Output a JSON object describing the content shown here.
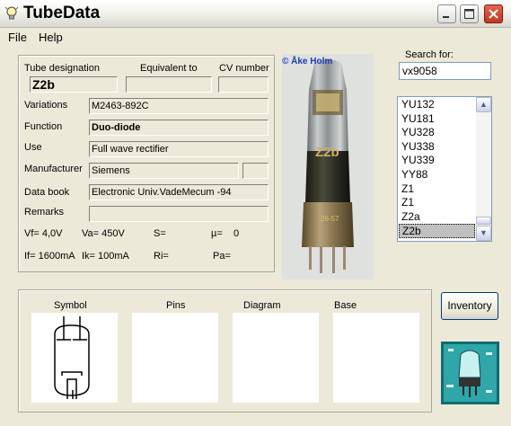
{
  "app": {
    "title": "TubeData"
  },
  "menu": {
    "file": "File",
    "help": "Help"
  },
  "header_labels": {
    "designation": "Tube designation",
    "equivalent": "Equivalent to",
    "cv": "CV number"
  },
  "tube": {
    "designation": "Z2b",
    "equivalent": "",
    "cv": "",
    "variations": "M2463-892C",
    "function": "Duo-diode",
    "use": "Full wave rectifier",
    "manufacturer": "Siemens",
    "manufacturer_extra": "",
    "databook": "Electronic Univ.VadeMecum -94",
    "remarks": ""
  },
  "field_labels": {
    "variations": "Variations",
    "function": "Function",
    "use": "Use",
    "manufacturer": "Manufacturer",
    "databook": "Data book",
    "remarks": "Remarks"
  },
  "params": {
    "vf": "Vf= 4,0V",
    "va": "Va= 450V",
    "s": "S=",
    "mu": "µ=",
    "mu_val": "0",
    "if": "If= 1600mA",
    "ik": "Ik= 100mA",
    "ri": "Ri=",
    "pa": "Pa="
  },
  "photo": {
    "credit": "© Åke Holm",
    "tube_print": "Z2b",
    "base_stamp": "26-57"
  },
  "search": {
    "label": "Search for:",
    "value": "vx9058"
  },
  "list": {
    "items": [
      "YU132",
      "YU181",
      "YU328",
      "YU338",
      "YU339",
      "YY88",
      "Z1",
      "Z1",
      "Z2a",
      "Z2b"
    ],
    "selected_index": 9
  },
  "bottom": {
    "symbol": "Symbol",
    "pins": "Pins",
    "diagram": "Diagram",
    "base": "Base"
  },
  "buttons": {
    "inventory": "Inventory"
  },
  "colors": {
    "title_close": "#c1381e",
    "list_selected": "#c0c0c0",
    "panel_bg": "#ece9d8"
  },
  "icons": {
    "app": "lightbulb-icon",
    "minimize": "minimize-icon",
    "maximize": "maximize-icon",
    "close": "close-icon",
    "scroll_up": "chevron-up-icon",
    "scroll_down": "chevron-down-icon"
  }
}
